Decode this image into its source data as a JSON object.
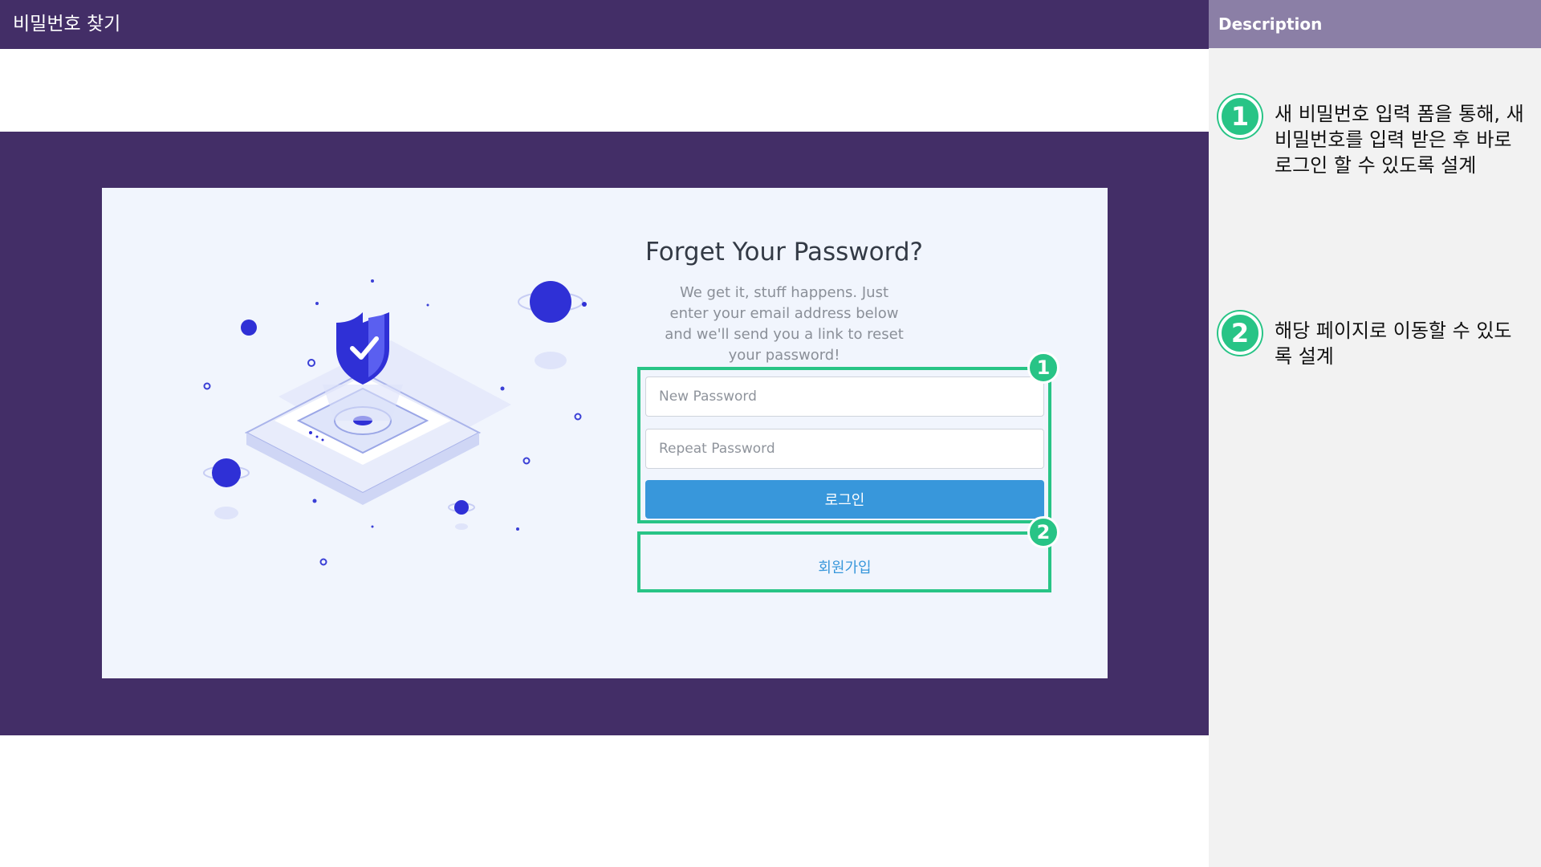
{
  "header": {
    "title": "비밀번호 찾기"
  },
  "form": {
    "title": "Forget Your Password?",
    "description": "We get it, stuff happens. Just enter your email address below and we'll send you a link to reset your password!",
    "new_password_placeholder": "New Password",
    "repeat_password_placeholder": "Repeat Password",
    "login_label": "로그인",
    "signup_label": "회원가입"
  },
  "callouts": [
    "1",
    "2"
  ],
  "description_panel": {
    "title": "Description",
    "notes": [
      {
        "number": "1",
        "text": "새 비밀번호 입력 폼을 통해, 새 비밀번호를 입력 받은 후 바로 로그인 할 수 있도록 설계"
      },
      {
        "number": "2",
        "text": "해당 페이지로 이동할 수 있도록 설계"
      }
    ]
  },
  "colors": {
    "header_bg": "#432e67",
    "accent_blue": "#3897db",
    "highlight_green": "#28c486",
    "panel_header": "#8b7fa6"
  }
}
